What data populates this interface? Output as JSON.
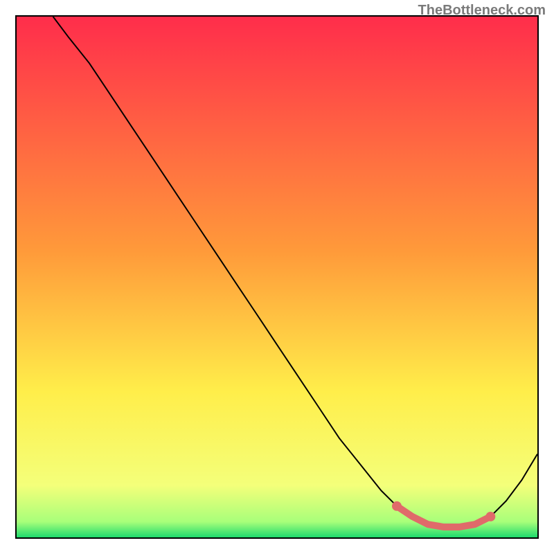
{
  "watermark": "TheBottleneck.com",
  "colors": {
    "curve": "#000000",
    "highlight": "#e06a6a",
    "gradient_stops": [
      {
        "offset": "0%",
        "color": "#ff2d4b"
      },
      {
        "offset": "45%",
        "color": "#ff9a3a"
      },
      {
        "offset": "72%",
        "color": "#ffee4a"
      },
      {
        "offset": "90%",
        "color": "#f4ff7a"
      },
      {
        "offset": "97%",
        "color": "#a8ff7a"
      },
      {
        "offset": "100%",
        "color": "#1edb6e"
      }
    ]
  },
  "chart_data": {
    "type": "line",
    "title": "",
    "xlabel": "",
    "ylabel": "",
    "xlim": [
      0,
      100
    ],
    "ylim": [
      0,
      100
    ],
    "grid": false,
    "legend": false,
    "x": [
      7,
      10,
      14,
      18,
      22,
      26,
      30,
      34,
      38,
      42,
      46,
      50,
      54,
      58,
      62,
      66,
      70,
      73,
      76,
      79,
      82,
      85,
      88,
      91,
      94,
      97,
      100
    ],
    "y": [
      100,
      96,
      91,
      85,
      79,
      73,
      67,
      61,
      55,
      49,
      43,
      37,
      31,
      25,
      19,
      14,
      9,
      6,
      4,
      2.5,
      2,
      2,
      2.5,
      4,
      7,
      11,
      16
    ],
    "highlight_range_x": [
      73,
      91
    ],
    "highlight_dots_x": [
      73,
      91
    ]
  }
}
